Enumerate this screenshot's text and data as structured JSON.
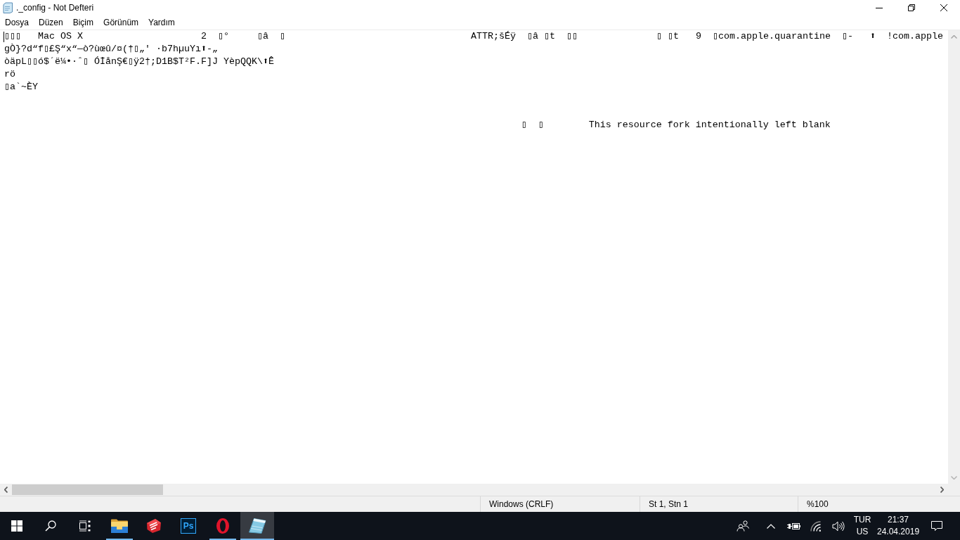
{
  "window": {
    "title": "._config - Not Defteri"
  },
  "menu": [
    "Dosya",
    "Düzen",
    "Biçim",
    "Görünüm",
    "Yardım"
  ],
  "editor": {
    "text": "▯▯▯   Mac OS X                     2  ▯°     ▯â  ▯                                 ATTR;šÉÿ  ▯â ▯t  ▯▯              ▯ ▯t   9  ▯com.apple.quarantine  ▯-   ⬆  !com.apple\ngÒ}?d“f▯£Ş“x“—ò?ùœû/¤(†▯„' ·b7hµuYı⬆-„\nòäpL▯▯ó$´ë¼•·ˆ▯ ÓİånŞ€▯ÿ2†;D1B$T²F.F]J YèpQQK\\⬆Ê\nrö\n▯a`~ÈY\n\n\n                                                                                            ▯  ▯        This resource fork intentionally left blank"
  },
  "status_bar": {
    "line_ending": "Windows (CRLF)",
    "position": "St 1, Stn 1",
    "zoom": "%100"
  },
  "taskbar": {
    "apps": [
      {
        "kind": "folder",
        "running": true,
        "selected": false
      },
      {
        "kind": "cube",
        "running": false,
        "selected": false
      },
      {
        "kind": "tile",
        "label": "Ps",
        "running": false,
        "selected": false
      },
      {
        "kind": "ring",
        "running": true,
        "selected": false
      },
      {
        "kind": "notepad",
        "running": true,
        "selected": true
      }
    ],
    "tray": {
      "language": "TUR",
      "layout": "US",
      "time": "21:37",
      "date": "24.04.2019"
    }
  }
}
